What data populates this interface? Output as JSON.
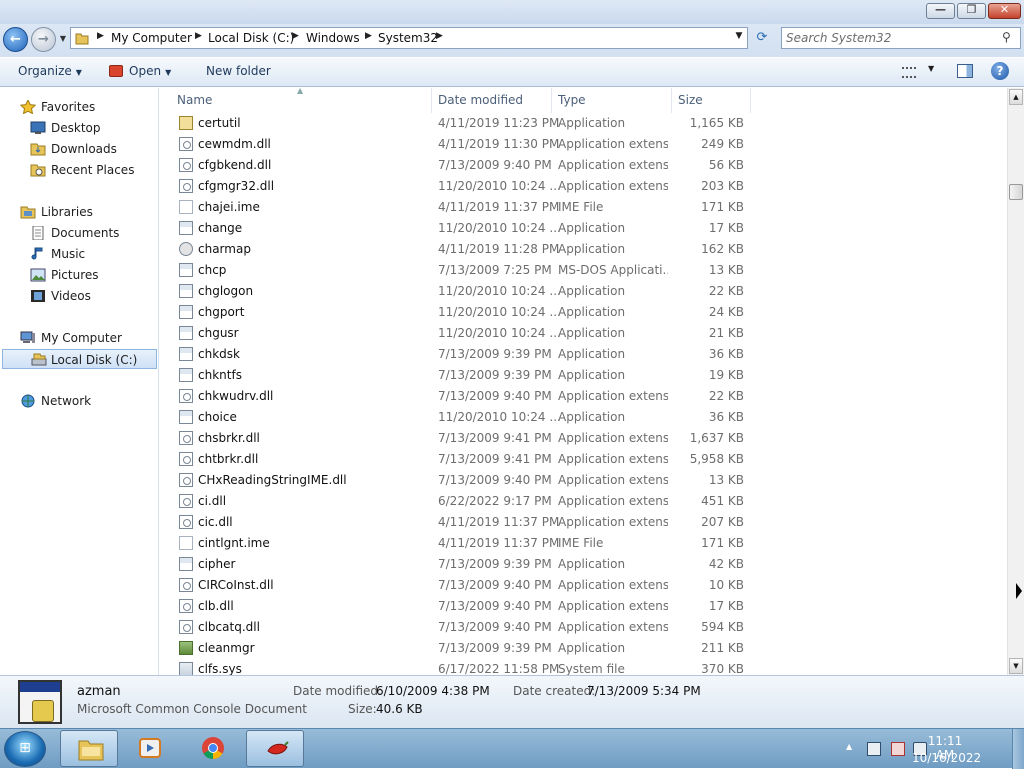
{
  "window": {
    "min_label": "—",
    "max_label": "❐",
    "close_label": "✕"
  },
  "address": {
    "back_label": "←",
    "forward_label": "→",
    "crumbs": [
      "My Computer",
      "Local Disk (C:)",
      "Windows",
      "System32"
    ],
    "search_placeholder": "Search System32"
  },
  "toolbar": {
    "organize_label": "Organize",
    "open_label": "Open",
    "new_folder_label": "New folder"
  },
  "nav": {
    "favorites": "Favorites",
    "desktop": "Desktop",
    "downloads": "Downloads",
    "recent_places": "Recent Places",
    "libraries": "Libraries",
    "documents": "Documents",
    "music": "Music",
    "pictures": "Pictures",
    "videos": "Videos",
    "my_computer": "My Computer",
    "local_disk": "Local Disk (C:)",
    "network": "Network"
  },
  "columns": {
    "name": "Name",
    "date_modified": "Date modified",
    "type": "Type",
    "size": "Size"
  },
  "files": [
    {
      "name": "certutil",
      "date": "4/11/2019 11:23 PM",
      "type": "Application",
      "size": "1,165 KB",
      "icon": "cert-icon"
    },
    {
      "name": "cewmdm.dll",
      "date": "4/11/2019 11:30 PM",
      "type": "Application extens...",
      "size": "249 KB",
      "icon": "dll-icon"
    },
    {
      "name": "cfgbkend.dll",
      "date": "7/13/2009 9:40 PM",
      "type": "Application extens...",
      "size": "56 KB",
      "icon": "dll-icon"
    },
    {
      "name": "cfgmgr32.dll",
      "date": "11/20/2010 10:24 ...",
      "type": "Application extens...",
      "size": "203 KB",
      "icon": "dll-icon"
    },
    {
      "name": "chajei.ime",
      "date": "4/11/2019 11:37 PM",
      "type": "IME File",
      "size": "171 KB",
      "icon": "ime-icon"
    },
    {
      "name": "change",
      "date": "11/20/2010 10:24 ...",
      "type": "Application",
      "size": "17 KB",
      "icon": "app-icon"
    },
    {
      "name": "charmap",
      "date": "4/11/2019 11:28 PM",
      "type": "Application",
      "size": "162 KB",
      "icon": "charmap-icon"
    },
    {
      "name": "chcp",
      "date": "7/13/2009 7:25 PM",
      "type": "MS-DOS Applicati...",
      "size": "13 KB",
      "icon": "app-icon"
    },
    {
      "name": "chglogon",
      "date": "11/20/2010 10:24 ...",
      "type": "Application",
      "size": "22 KB",
      "icon": "app-icon"
    },
    {
      "name": "chgport",
      "date": "11/20/2010 10:24 ...",
      "type": "Application",
      "size": "24 KB",
      "icon": "app-icon"
    },
    {
      "name": "chgusr",
      "date": "11/20/2010 10:24 ...",
      "type": "Application",
      "size": "21 KB",
      "icon": "app-icon"
    },
    {
      "name": "chkdsk",
      "date": "7/13/2009 9:39 PM",
      "type": "Application",
      "size": "36 KB",
      "icon": "app-icon"
    },
    {
      "name": "chkntfs",
      "date": "7/13/2009 9:39 PM",
      "type": "Application",
      "size": "19 KB",
      "icon": "app-icon"
    },
    {
      "name": "chkwudrv.dll",
      "date": "7/13/2009 9:40 PM",
      "type": "Application extens...",
      "size": "22 KB",
      "icon": "dll-icon"
    },
    {
      "name": "choice",
      "date": "11/20/2010 10:24 ...",
      "type": "Application",
      "size": "36 KB",
      "icon": "app-icon"
    },
    {
      "name": "chsbrkr.dll",
      "date": "7/13/2009 9:41 PM",
      "type": "Application extens...",
      "size": "1,637 KB",
      "icon": "dll-icon"
    },
    {
      "name": "chtbrkr.dll",
      "date": "7/13/2009 9:41 PM",
      "type": "Application extens...",
      "size": "5,958 KB",
      "icon": "dll-icon"
    },
    {
      "name": "CHxReadingStringIME.dll",
      "date": "7/13/2009 9:40 PM",
      "type": "Application extens...",
      "size": "13 KB",
      "icon": "dll-icon"
    },
    {
      "name": "ci.dll",
      "date": "6/22/2022 9:17 PM",
      "type": "Application extens...",
      "size": "451 KB",
      "icon": "dll-icon"
    },
    {
      "name": "cic.dll",
      "date": "4/11/2019 11:37 PM",
      "type": "Application extens...",
      "size": "207 KB",
      "icon": "dll-icon"
    },
    {
      "name": "cintlgnt.ime",
      "date": "4/11/2019 11:37 PM",
      "type": "IME File",
      "size": "171 KB",
      "icon": "ime-icon"
    },
    {
      "name": "cipher",
      "date": "7/13/2009 9:39 PM",
      "type": "Application",
      "size": "42 KB",
      "icon": "app-icon"
    },
    {
      "name": "CIRCoInst.dll",
      "date": "7/13/2009 9:40 PM",
      "type": "Application extens...",
      "size": "10 KB",
      "icon": "dll-icon"
    },
    {
      "name": "clb.dll",
      "date": "7/13/2009 9:40 PM",
      "type": "Application extens...",
      "size": "17 KB",
      "icon": "dll-icon"
    },
    {
      "name": "clbcatq.dll",
      "date": "7/13/2009 9:40 PM",
      "type": "Application extens...",
      "size": "594 KB",
      "icon": "dll-icon"
    },
    {
      "name": "cleanmgr",
      "date": "7/13/2009 9:39 PM",
      "type": "Application",
      "size": "211 KB",
      "icon": "cleanmgr-icon"
    },
    {
      "name": "clfs.sys",
      "date": "6/17/2022 11:58 PM",
      "type": "System file",
      "size": "370 KB",
      "icon": "sys-icon"
    }
  ],
  "details": {
    "name": "azman",
    "type": "Microsoft Common Console Document",
    "date_modified_label": "Date modified:",
    "date_modified": "6/10/2009 4:38 PM",
    "date_created_label": "Date created:",
    "date_created": "7/13/2009 5:34 PM",
    "size_label": "Size:",
    "size": "40.6 KB"
  },
  "taskbar": {
    "start_glyph": "⊞",
    "clock_time": "11:11 AM",
    "clock_date": "10/16/2022"
  },
  "colors": {
    "accent": "#1f62b8",
    "taskbar": "#6f9cc3",
    "close_button": "#c3432d"
  }
}
